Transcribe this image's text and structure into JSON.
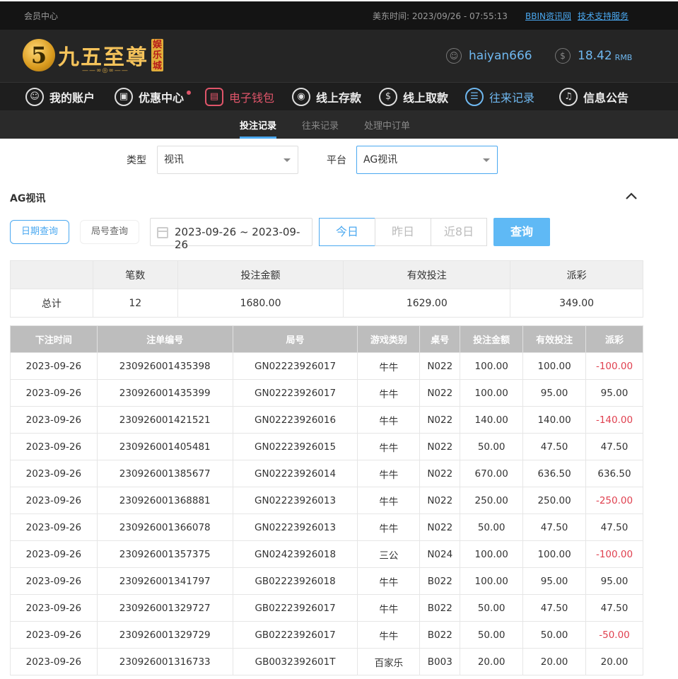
{
  "topbar": {
    "member_center": "会员中心",
    "time_label": "美东时间:",
    "time_value": "2023/09/26 - 07:55:13",
    "link_bbin": "BBIN资讯网",
    "link_support": "技术支持服务"
  },
  "logo": {
    "mark": "5",
    "name": "九五至尊",
    "badge": "娱乐城",
    "sub": "——∞◎∞——"
  },
  "user": {
    "username": "haiyan666",
    "balance": "18.42",
    "currency": "RMB",
    "user_icon": "user-icon",
    "money_icon": "dollar-icon"
  },
  "nav": {
    "items": [
      {
        "label": "我的账户",
        "icon": "user-icon"
      },
      {
        "label": "优惠中心",
        "icon": "gift-icon"
      },
      {
        "label": "电子钱包",
        "icon": "wallet-icon"
      },
      {
        "label": "线上存款",
        "icon": "deposit-icon"
      },
      {
        "label": "线上取款",
        "icon": "withdraw-icon"
      },
      {
        "label": "往来记录",
        "icon": "records-icon"
      },
      {
        "label": "信息公告",
        "icon": "bell-icon"
      }
    ]
  },
  "subnav": {
    "tabs": [
      "投注记录",
      "往来记录",
      "处理中订单"
    ]
  },
  "filters": {
    "type_label": "类型",
    "type_value": "视讯",
    "platform_label": "平台",
    "platform_value": "AG视讯"
  },
  "section": {
    "title": "AG视讯"
  },
  "query": {
    "date_query": "日期查询",
    "round_query": "局号查询",
    "date_range": "2023-09-26 ~ 2023-09-26",
    "today": "今日",
    "yesterday": "昨日",
    "last8": "近8日",
    "search": "查询"
  },
  "summary": {
    "headers": [
      "",
      "笔数",
      "投注金额",
      "有效投注",
      "派彩"
    ],
    "row": [
      "总计",
      "12",
      "1680.00",
      "1629.00",
      "349.00"
    ]
  },
  "records": {
    "headers": [
      "下注时间",
      "注单编号",
      "局号",
      "游戏类别",
      "桌号",
      "投注金额",
      "有效投注",
      "派彩"
    ],
    "rows": [
      [
        "2023-09-26",
        "230926001435398",
        "GN02223926017",
        "牛牛",
        "N022",
        "100.00",
        "100.00",
        "-100.00"
      ],
      [
        "2023-09-26",
        "230926001435399",
        "GN02223926017",
        "牛牛",
        "N022",
        "100.00",
        "95.00",
        "95.00"
      ],
      [
        "2023-09-26",
        "230926001421521",
        "GN02223926016",
        "牛牛",
        "N022",
        "140.00",
        "140.00",
        "-140.00"
      ],
      [
        "2023-09-26",
        "230926001405481",
        "GN02223926015",
        "牛牛",
        "N022",
        "50.00",
        "47.50",
        "47.50"
      ],
      [
        "2023-09-26",
        "230926001385677",
        "GN02223926014",
        "牛牛",
        "N022",
        "670.00",
        "636.50",
        "636.50"
      ],
      [
        "2023-09-26",
        "230926001368881",
        "GN02223926013",
        "牛牛",
        "N022",
        "250.00",
        "250.00",
        "-250.00"
      ],
      [
        "2023-09-26",
        "230926001366078",
        "GN02223926013",
        "牛牛",
        "N022",
        "50.00",
        "47.50",
        "47.50"
      ],
      [
        "2023-09-26",
        "230926001357375",
        "GN02423926018",
        "三公",
        "N024",
        "100.00",
        "100.00",
        "-100.00"
      ],
      [
        "2023-09-26",
        "230926001341797",
        "GB02223926018",
        "牛牛",
        "B022",
        "100.00",
        "95.00",
        "95.00"
      ],
      [
        "2023-09-26",
        "230926001329727",
        "GB02223926017",
        "牛牛",
        "B022",
        "50.00",
        "47.50",
        "47.50"
      ],
      [
        "2023-09-26",
        "230926001329729",
        "GB02223926017",
        "牛牛",
        "B022",
        "50.00",
        "50.00",
        "-50.00"
      ],
      [
        "2023-09-26",
        "230926001316733",
        "GB0032392601T",
        "百家乐",
        "B003",
        "20.00",
        "20.00",
        "20.00"
      ]
    ]
  },
  "colors": {
    "accent": "#4aa8f0",
    "negative": "#e0404f",
    "nav_highlight": "#e0556a"
  }
}
